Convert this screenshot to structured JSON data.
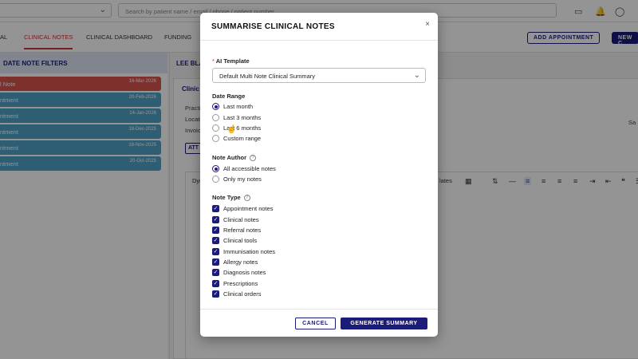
{
  "topbar": {
    "search_placeholder": "Search by patient name / email / phone / patient number",
    "icons": [
      "inbox-icon",
      "bell-icon",
      "chat-icon"
    ]
  },
  "nav": {
    "tabs": [
      "AL",
      "CLINICAL NOTES",
      "CLINICAL DASHBOARD",
      "FUNDING"
    ],
    "active_tab": "CLINICAL NOTES",
    "add_appointment": "ADD APPOINTMENT",
    "new_button": "NEW C"
  },
  "left": {
    "header": "DATE NOTE FILTERS",
    "rows": [
      {
        "label": "l Note",
        "date": "16-Mar-2026",
        "color": "#d9534f"
      },
      {
        "label": "ntment",
        "date": "20-Feb-2026",
        "color": "#4fa3c7"
      },
      {
        "label": "ntment",
        "date": "14-Jan-2026",
        "color": "#4fa3c7"
      },
      {
        "label": "ntment",
        "date": "18-Dec-2025",
        "color": "#4fa3c7"
      },
      {
        "label": "ntment",
        "date": "18-Nov-2025",
        "color": "#4fa3c7"
      },
      {
        "label": "ntment",
        "date": "20-Oct-2025",
        "color": "#4fa3c7"
      }
    ]
  },
  "right": {
    "patient_name": "LEE BLA",
    "card_title": "Clinic",
    "labels": [
      "Practi",
      "Locati",
      "Invoic"
    ],
    "attach": "ATT",
    "editor_label": "Dyn",
    "templates": "lates",
    "side_text": "Sa"
  },
  "modal": {
    "title": "SUMMARISE CLINICAL NOTES",
    "close": "×",
    "ai_template": {
      "required_mark": "*",
      "label": "AI Template",
      "value": "Default Multi Note Clinical Summary"
    },
    "date_range": {
      "label": "Date Range",
      "options": [
        "Last month",
        "Last 3 months",
        "Last 6 months",
        "Custom range"
      ],
      "selected": "Last month"
    },
    "note_author": {
      "label": "Note Author",
      "options": [
        "All accessible notes",
        "Only my notes"
      ],
      "selected": "All accessible notes"
    },
    "note_type": {
      "label": "Note Type",
      "options": [
        "Appointment notes",
        "Clinical notes",
        "Referral notes",
        "Clinical tools",
        "Immunisation notes",
        "Allergy notes",
        "Diagnosis notes",
        "Prescriptions",
        "Clinical orders"
      ],
      "all_checked": true
    },
    "cancel": "CANCEL",
    "generate": "GENERATE SUMMARY"
  }
}
